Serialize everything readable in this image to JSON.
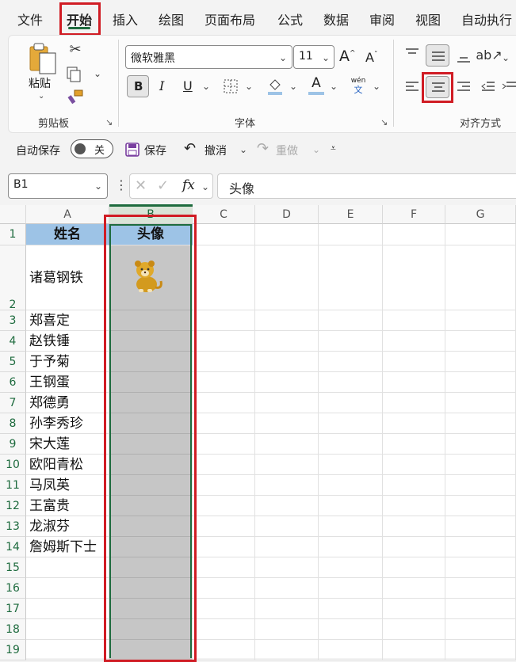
{
  "menu": {
    "tabs": [
      "文件",
      "开始",
      "插入",
      "绘图",
      "页面布局",
      "公式",
      "数据",
      "审阅",
      "视图",
      "自动执行"
    ],
    "active_tab": "开始"
  },
  "ribbon": {
    "clipboard": {
      "paste_label": "粘贴",
      "group_label": "剪贴板"
    },
    "font": {
      "font_name": "微软雅黑",
      "font_size": "11",
      "group_label": "字体",
      "bold": "B",
      "italic": "I",
      "underline": "U",
      "phonetic_top": "wén",
      "phonetic_bottom": "文",
      "increase_size": "A",
      "decrease_size": "A",
      "font_color_letter": "A"
    },
    "alignment": {
      "group_label": "对齐方式",
      "selected": "center-align"
    }
  },
  "quick_access": {
    "autosave_label": "自动保存",
    "autosave_state": "关",
    "save_label": "保存",
    "undo_label": "撤消",
    "redo_label": "重做"
  },
  "formula_bar": {
    "name_box": "B1",
    "fx": "fx",
    "content": "头像"
  },
  "sheet": {
    "columns": [
      "A",
      "B",
      "C",
      "D",
      "E",
      "F",
      "G"
    ],
    "rows": [
      "1",
      "2",
      "3",
      "4",
      "5",
      "6",
      "7",
      "8",
      "9",
      "10",
      "11",
      "12",
      "13",
      "14",
      "15",
      "16",
      "17",
      "18",
      "19"
    ],
    "header": {
      "a": "姓名",
      "b": "头像"
    },
    "names": [
      "诸葛钢铁",
      "郑喜定",
      "赵铁锤",
      "于予菊",
      "王钢蛋",
      "郑德勇",
      "孙李秀珍",
      "宋大莲",
      "欧阳青松",
      "马凤英",
      "王富贵",
      "龙淑芬",
      "詹姆斯下士"
    ],
    "avatar_icon": "tiger-cub-avatar",
    "colors": {
      "accent": "#1e6b3e",
      "highlight": "#d01c24",
      "header_fill": "#9dc3e6",
      "selected_fill": "#c6c6c6"
    }
  }
}
